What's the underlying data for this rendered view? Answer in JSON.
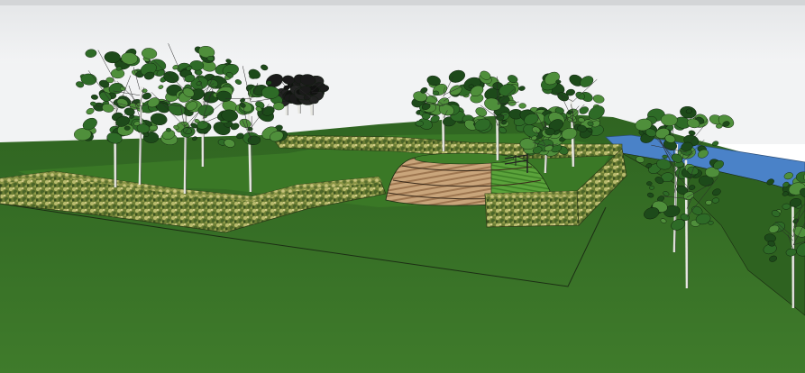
{
  "scene": {
    "description_visible_text": [],
    "colors": {
      "sky_top": "#e6e8ea",
      "sky_bottom": "#f4f5f6",
      "haze": "#d9dadb",
      "ground_near": "#3f7a2a",
      "ground_far": "#2f6120",
      "lawn_inside": "#3c7a28",
      "hedge_light": "#b6b86a",
      "hedge_dark": "#3e5a22",
      "mound_wood": "#c7a37a",
      "mound_wood_dark": "#8e6b46",
      "mound_grass": "#5aa23a",
      "water": "#4a82c8",
      "outline": "#1a2a12",
      "trunk": "#e8e8e2",
      "foliage_dark": "#1d4a1a",
      "foliage_mid": "#2e6b27",
      "foliage_light": "#4f8f3b"
    },
    "icons": [
      "birch-tree",
      "hedge",
      "earth-mound",
      "water-canal"
    ]
  }
}
